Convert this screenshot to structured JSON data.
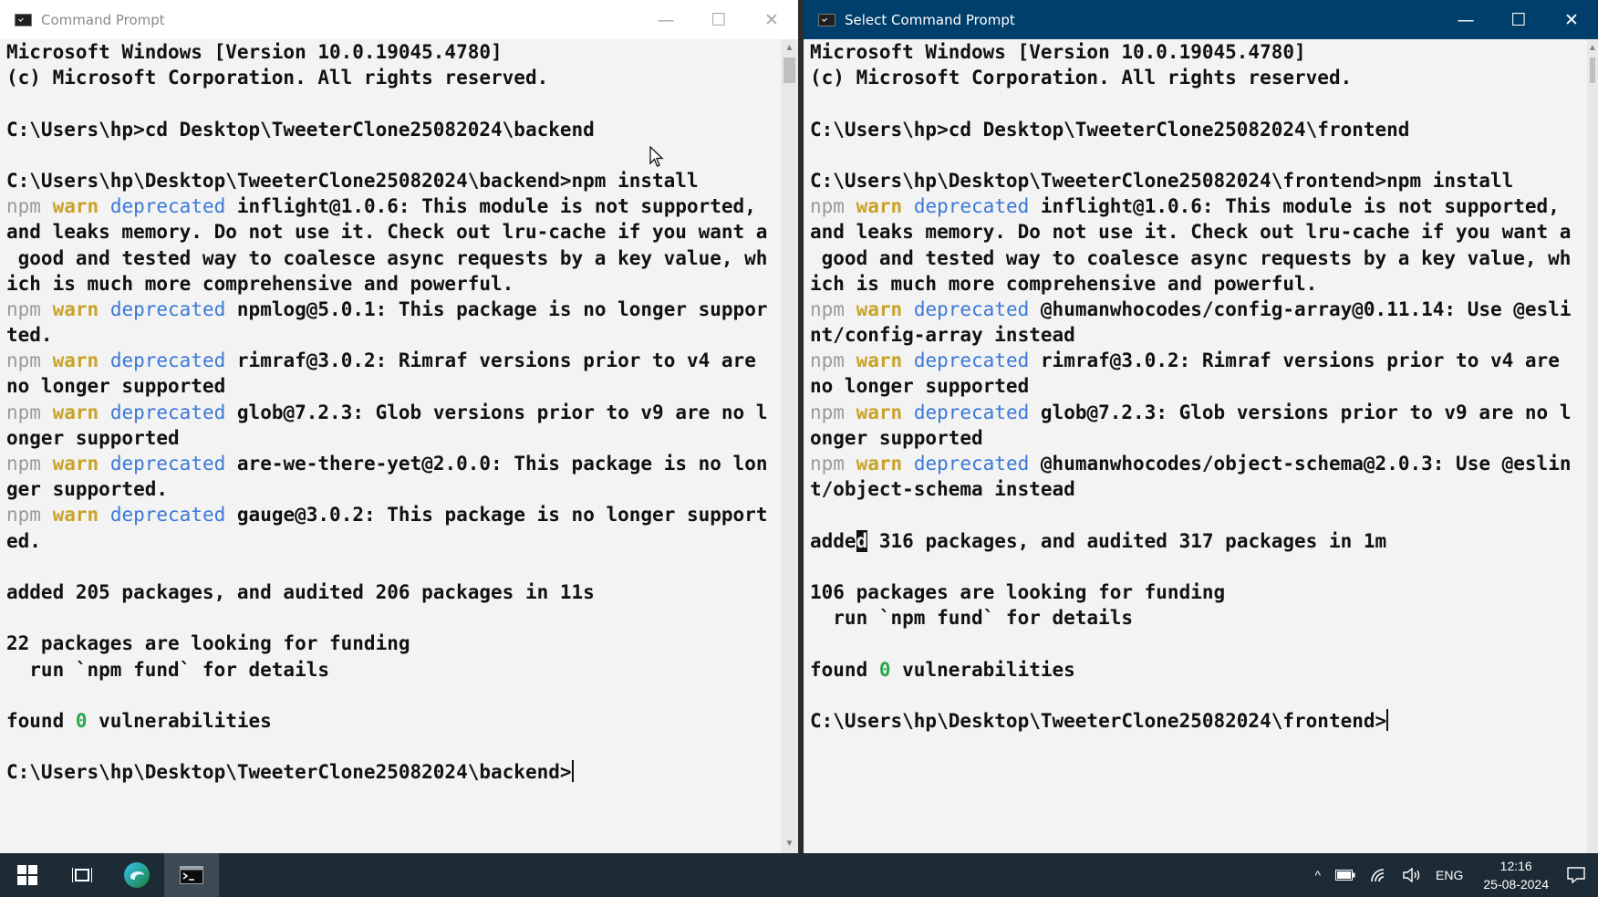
{
  "colors": {
    "console_bg": "#f3f3f3",
    "text": "#111111",
    "npm": "#9a9a9a",
    "warn": "#c9a227",
    "deprecated": "#3b78d8",
    "zero": "#2aa84a",
    "active_title": "#003e6b",
    "taskbar": "#1c2b36"
  },
  "left_window": {
    "title": "Command Prompt",
    "controls": {
      "minimize": "—",
      "maximize": "☐",
      "close": "✕"
    },
    "lines": [
      [
        {
          "t": "Microsoft Windows [Version 10.0.19045.4780]"
        }
      ],
      [
        {
          "t": "(c) Microsoft Corporation. All rights reserved."
        }
      ],
      [],
      [
        {
          "t": "C:\\Users\\hp>cd Desktop\\TweeterClone25082024\\backend"
        }
      ],
      [],
      [
        {
          "t": "C:\\Users\\hp\\Desktop\\TweeterClone25082024\\backend>npm install"
        }
      ],
      [
        {
          "t": "npm",
          "c": "npm"
        },
        {
          "t": " "
        },
        {
          "t": "warn",
          "c": "warn"
        },
        {
          "t": " "
        },
        {
          "t": "deprecated",
          "c": "dep"
        },
        {
          "t": " inflight@1.0.6: This module is not supported,"
        }
      ],
      [
        {
          "t": "and leaks memory. Do not use it. Check out lru-cache if you want a"
        }
      ],
      [
        {
          "t": " good and tested way to coalesce async requests by a key value, wh"
        }
      ],
      [
        {
          "t": "ich is much more comprehensive and powerful."
        }
      ],
      [
        {
          "t": "npm",
          "c": "npm"
        },
        {
          "t": " "
        },
        {
          "t": "warn",
          "c": "warn"
        },
        {
          "t": " "
        },
        {
          "t": "deprecated",
          "c": "dep"
        },
        {
          "t": " npmlog@5.0.1: This package is no longer suppor"
        }
      ],
      [
        {
          "t": "ted."
        }
      ],
      [
        {
          "t": "npm",
          "c": "npm"
        },
        {
          "t": " "
        },
        {
          "t": "warn",
          "c": "warn"
        },
        {
          "t": " "
        },
        {
          "t": "deprecated",
          "c": "dep"
        },
        {
          "t": " rimraf@3.0.2: Rimraf versions prior to v4 are"
        }
      ],
      [
        {
          "t": "no longer supported"
        }
      ],
      [
        {
          "t": "npm",
          "c": "npm"
        },
        {
          "t": " "
        },
        {
          "t": "warn",
          "c": "warn"
        },
        {
          "t": " "
        },
        {
          "t": "deprecated",
          "c": "dep"
        },
        {
          "t": " glob@7.2.3: Glob versions prior to v9 are no l"
        }
      ],
      [
        {
          "t": "onger supported"
        }
      ],
      [
        {
          "t": "npm",
          "c": "npm"
        },
        {
          "t": " "
        },
        {
          "t": "warn",
          "c": "warn"
        },
        {
          "t": " "
        },
        {
          "t": "deprecated",
          "c": "dep"
        },
        {
          "t": " are-we-there-yet@2.0.0: This package is no lon"
        }
      ],
      [
        {
          "t": "ger supported."
        }
      ],
      [
        {
          "t": "npm",
          "c": "npm"
        },
        {
          "t": " "
        },
        {
          "t": "warn",
          "c": "warn"
        },
        {
          "t": " "
        },
        {
          "t": "deprecated",
          "c": "dep"
        },
        {
          "t": " gauge@3.0.2: This package is no longer support"
        }
      ],
      [
        {
          "t": "ed."
        }
      ],
      [],
      [
        {
          "t": "added 205 packages, and audited 206 packages in 11s"
        }
      ],
      [],
      [
        {
          "t": "22 packages are looking for funding"
        }
      ],
      [
        {
          "t": "  run `npm fund` for details"
        }
      ],
      [],
      [
        {
          "t": "found "
        },
        {
          "t": "0",
          "c": "zero"
        },
        {
          "t": " vulnerabilities"
        }
      ],
      [],
      [
        {
          "t": "C:\\Users\\hp\\Desktop\\TweeterClone25082024\\backend>"
        },
        {
          "t": "",
          "c": "cursor-bar"
        }
      ]
    ]
  },
  "right_window": {
    "title": "Select Command Prompt",
    "controls": {
      "minimize": "—",
      "maximize": "☐",
      "close": "✕"
    },
    "lines": [
      [
        {
          "t": "Microsoft Windows [Version 10.0.19045.4780]"
        }
      ],
      [
        {
          "t": "(c) Microsoft Corporation. All rights reserved."
        }
      ],
      [],
      [
        {
          "t": "C:\\Users\\hp>cd Desktop\\TweeterClone25082024\\frontend"
        }
      ],
      [],
      [
        {
          "t": "C:\\Users\\hp\\Desktop\\TweeterClone25082024\\frontend>npm install"
        }
      ],
      [
        {
          "t": "npm",
          "c": "npm"
        },
        {
          "t": " "
        },
        {
          "t": "warn",
          "c": "warn"
        },
        {
          "t": " "
        },
        {
          "t": "deprecated",
          "c": "dep"
        },
        {
          "t": " inflight@1.0.6: This module is not supported,"
        }
      ],
      [
        {
          "t": "and leaks memory. Do not use it. Check out lru-cache if you want a"
        }
      ],
      [
        {
          "t": " good and tested way to coalesce async requests by a key value, wh"
        }
      ],
      [
        {
          "t": "ich is much more comprehensive and powerful."
        }
      ],
      [
        {
          "t": "npm",
          "c": "npm"
        },
        {
          "t": " "
        },
        {
          "t": "warn",
          "c": "warn"
        },
        {
          "t": " "
        },
        {
          "t": "deprecated",
          "c": "dep"
        },
        {
          "t": " @humanwhocodes/config-array@0.11.14: Use @esli"
        }
      ],
      [
        {
          "t": "nt/config-array instead"
        }
      ],
      [
        {
          "t": "npm",
          "c": "npm"
        },
        {
          "t": " "
        },
        {
          "t": "warn",
          "c": "warn"
        },
        {
          "t": " "
        },
        {
          "t": "deprecated",
          "c": "dep"
        },
        {
          "t": " rimraf@3.0.2: Rimraf versions prior to v4 are"
        }
      ],
      [
        {
          "t": "no longer supported"
        }
      ],
      [
        {
          "t": "npm",
          "c": "npm"
        },
        {
          "t": " "
        },
        {
          "t": "warn",
          "c": "warn"
        },
        {
          "t": " "
        },
        {
          "t": "deprecated",
          "c": "dep"
        },
        {
          "t": " glob@7.2.3: Glob versions prior to v9 are no l"
        }
      ],
      [
        {
          "t": "onger supported"
        }
      ],
      [
        {
          "t": "npm",
          "c": "npm"
        },
        {
          "t": " "
        },
        {
          "t": "warn",
          "c": "warn"
        },
        {
          "t": " "
        },
        {
          "t": "deprecated",
          "c": "dep"
        },
        {
          "t": " @humanwhocodes/object-schema@2.0.3: Use @eslin"
        }
      ],
      [
        {
          "t": "t/object-schema instead"
        }
      ],
      [],
      [
        {
          "t": "adde"
        },
        {
          "t": "d",
          "c": "cursor-block"
        },
        {
          "t": " 316 packages, and audited 317 packages in 1m"
        }
      ],
      [],
      [
        {
          "t": "106 packages are looking for funding"
        }
      ],
      [
        {
          "t": "  run `npm fund` for details"
        }
      ],
      [],
      [
        {
          "t": "found "
        },
        {
          "t": "0",
          "c": "zero"
        },
        {
          "t": " vulnerabilities"
        }
      ],
      [],
      [
        {
          "t": "C:\\Users\\hp\\Desktop\\TweeterClone25082024\\frontend>"
        },
        {
          "t": "",
          "c": "cursor-bar"
        }
      ]
    ]
  },
  "taskbar": {
    "tray": {
      "chevron": "^",
      "language": "ENG",
      "time": "12:16",
      "date": "25-08-2024"
    }
  }
}
